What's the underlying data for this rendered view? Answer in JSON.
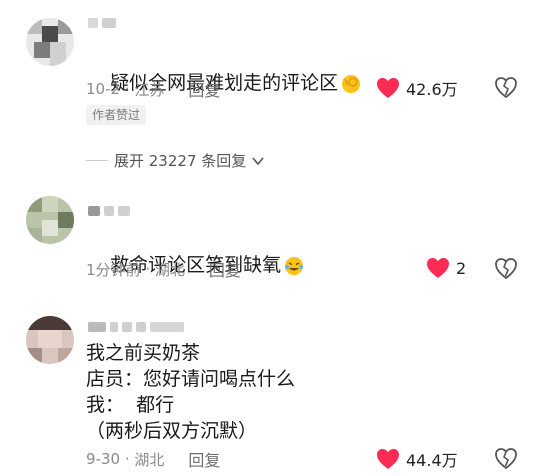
{
  "comments": [
    {
      "text": "疑似全网最难划走的评论区",
      "emoji_icon": "ok-hand-emoji",
      "date": "10-2",
      "location": "江苏",
      "reply_label": "回复",
      "badge": "作者赞过",
      "likes": "42.6万",
      "liked": true,
      "expand_label": "展开 23227 条回复"
    },
    {
      "text": "救命评论区笑到缺氧",
      "emoji_icon": "crying-laughing-emoji",
      "date": "1分钟前",
      "location": "湖北",
      "reply_label": "回复",
      "likes": "2",
      "liked": true
    },
    {
      "text_lines": [
        "我之前买奶茶",
        "店员：您好请问喝点什么",
        "我：  都行",
        "（两秒后双方沉默）"
      ],
      "date": "9-30",
      "location": "湖北",
      "reply_label": "回复",
      "likes": "44.4万",
      "liked": true
    }
  ],
  "colors": {
    "like_red": "#fe2c55",
    "meta_gray": "#8a8a8a"
  }
}
